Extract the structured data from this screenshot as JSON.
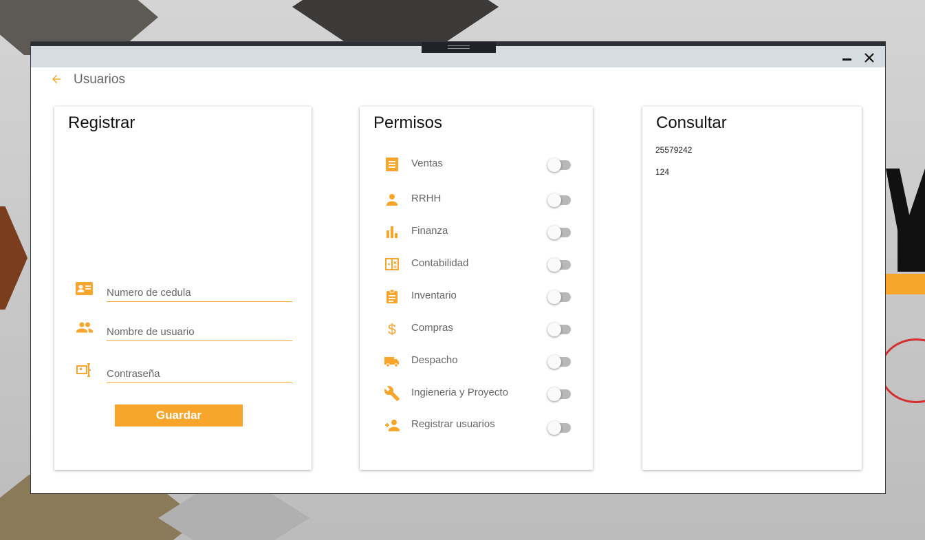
{
  "window": {
    "title": "Usuarios"
  },
  "colors": {
    "accent": "#f7a52b",
    "titlebar": "#d6dde2",
    "text_muted": "#666666"
  },
  "icons": {
    "back": "arrow-left-icon",
    "minimize": "minimize-icon",
    "close": "close-icon",
    "cedula": "id-card-icon",
    "usuario": "people-icon",
    "contrasena": "password-icon"
  },
  "registrar": {
    "title": "Registrar",
    "fields": [
      {
        "placeholder": "Numero de cedula",
        "value": ""
      },
      {
        "placeholder": "Nombre de usuario",
        "value": ""
      },
      {
        "placeholder": "Contraseña",
        "value": ""
      }
    ],
    "save_label": "Guardar"
  },
  "permisos": {
    "title": "Permisos",
    "items": [
      {
        "label": "Ventas",
        "icon": "receipt-icon",
        "enabled": false
      },
      {
        "label": "RRHH",
        "icon": "person-icon",
        "enabled": false
      },
      {
        "label": "Finanza",
        "icon": "bar-chart-icon",
        "enabled": false
      },
      {
        "label": "Contabilidad",
        "icon": "calculator-icon",
        "enabled": false
      },
      {
        "label": "Inventario",
        "icon": "clipboard-icon",
        "enabled": false
      },
      {
        "label": "Compras",
        "icon": "dollar-icon",
        "enabled": false
      },
      {
        "label": "Despacho",
        "icon": "truck-icon",
        "enabled": false
      },
      {
        "label": "Ingieneria y Proyecto",
        "icon": "wrench-icon",
        "enabled": false
      },
      {
        "label": "Registrar usuarios",
        "icon": "person-add-icon",
        "enabled": false
      }
    ]
  },
  "consultar": {
    "title": "Consultar",
    "items": [
      "25579242",
      "124"
    ]
  }
}
